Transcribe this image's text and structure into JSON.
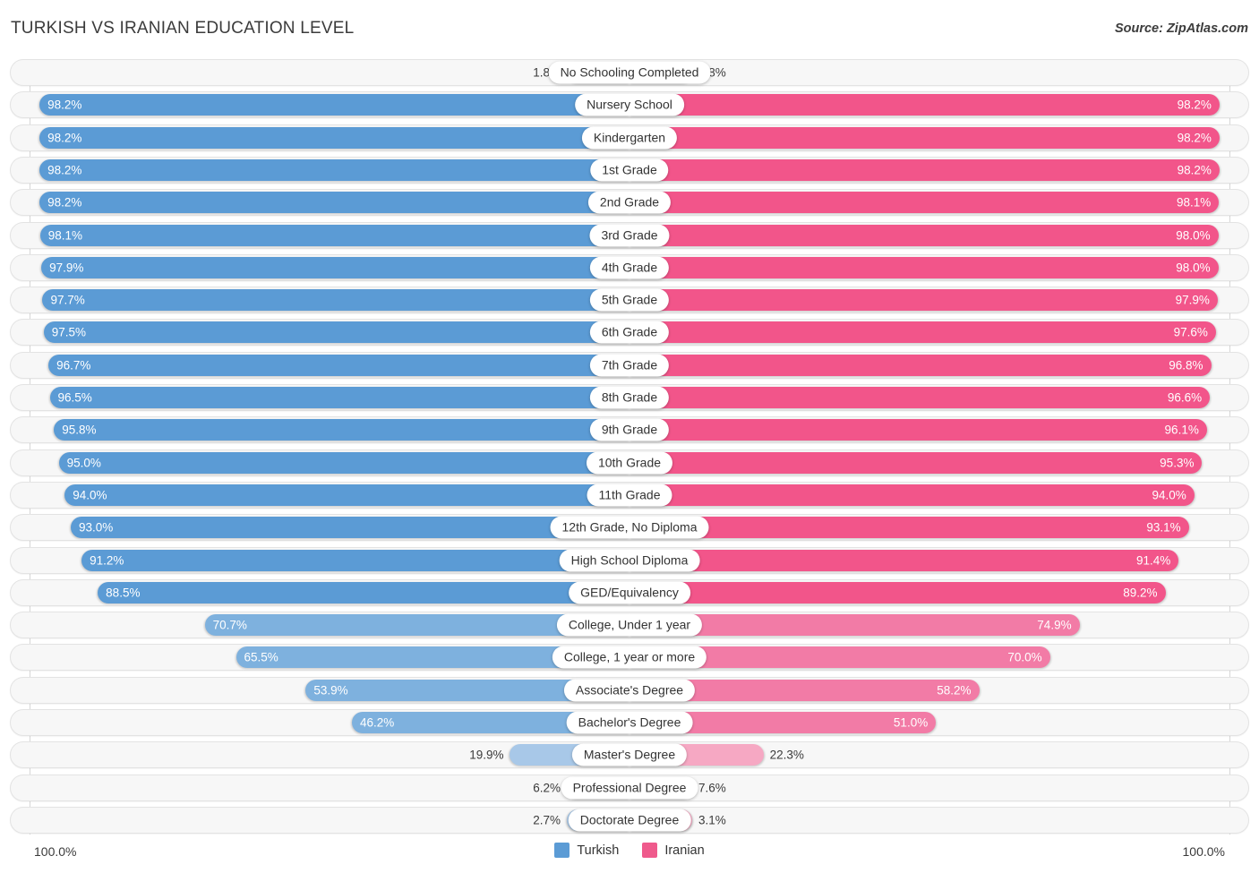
{
  "header": {
    "title": "TURKISH VS IRANIAN EDUCATION LEVEL",
    "source": "Source: ZipAtlas.com"
  },
  "footer": {
    "axis_min": "100.0%",
    "axis_max": "100.0%",
    "legend": [
      {
        "label": "Turkish",
        "color": "#5b9bd5"
      },
      {
        "label": "Iranian",
        "color": "#ef5a8c"
      }
    ]
  },
  "colors": {
    "turkish_strong": "#5b9bd5",
    "turkish_mid": "#7eb1de",
    "turkish_light": "#a8c8e8",
    "iranian_strong": "#f2558a",
    "iranian_mid": "#f27ba6",
    "iranian_light": "#f6a8c3",
    "track": "#f7f7f7",
    "track_border": "#e3e3e3"
  },
  "chart_data": {
    "type": "bar",
    "orientation": "horizontal-diverging",
    "title": "TURKISH VS IRANIAN EDUCATION LEVEL",
    "xlabel": "",
    "ylabel": "",
    "xlim": [
      0,
      100
    ],
    "grid": false,
    "legend_position": "bottom-center",
    "axis_min_label": "100.0%",
    "axis_max_label": "100.0%",
    "categories": [
      "No Schooling Completed",
      "Nursery School",
      "Kindergarten",
      "1st Grade",
      "2nd Grade",
      "3rd Grade",
      "4th Grade",
      "5th Grade",
      "6th Grade",
      "7th Grade",
      "8th Grade",
      "9th Grade",
      "10th Grade",
      "11th Grade",
      "12th Grade, No Diploma",
      "High School Diploma",
      "GED/Equivalency",
      "College, Under 1 year",
      "College, 1 year or more",
      "Associate's Degree",
      "Bachelor's Degree",
      "Master's Degree",
      "Professional Degree",
      "Doctorate Degree"
    ],
    "series": [
      {
        "name": "Turkish",
        "color": "#5b9bd5",
        "values": [
          1.8,
          98.2,
          98.2,
          98.2,
          98.2,
          98.1,
          97.9,
          97.7,
          97.5,
          96.7,
          96.5,
          95.8,
          95.0,
          94.0,
          93.0,
          91.2,
          88.5,
          70.7,
          65.5,
          53.9,
          46.2,
          19.9,
          6.2,
          2.7
        ],
        "labels": [
          "1.8%",
          "98.2%",
          "98.2%",
          "98.2%",
          "98.2%",
          "98.1%",
          "97.9%",
          "97.7%",
          "97.5%",
          "96.7%",
          "96.5%",
          "95.8%",
          "95.0%",
          "94.0%",
          "93.0%",
          "91.2%",
          "88.5%",
          "70.7%",
          "65.5%",
          "53.9%",
          "46.2%",
          "19.9%",
          "6.2%",
          "2.7%"
        ]
      },
      {
        "name": "Iranian",
        "color": "#f2558a",
        "values": [
          1.8,
          98.2,
          98.2,
          98.2,
          98.1,
          98.0,
          98.0,
          97.9,
          97.6,
          96.8,
          96.6,
          96.1,
          95.3,
          94.0,
          93.1,
          91.4,
          89.2,
          74.9,
          70.0,
          58.2,
          51.0,
          22.3,
          7.6,
          3.1
        ],
        "labels": [
          "1.8%",
          "98.2%",
          "98.2%",
          "98.2%",
          "98.1%",
          "98.0%",
          "98.0%",
          "97.9%",
          "97.6%",
          "96.8%",
          "96.6%",
          "96.1%",
          "95.3%",
          "94.0%",
          "93.1%",
          "91.4%",
          "89.2%",
          "74.9%",
          "70.0%",
          "58.2%",
          "51.0%",
          "22.3%",
          "7.6%",
          "3.1%"
        ]
      }
    ]
  }
}
